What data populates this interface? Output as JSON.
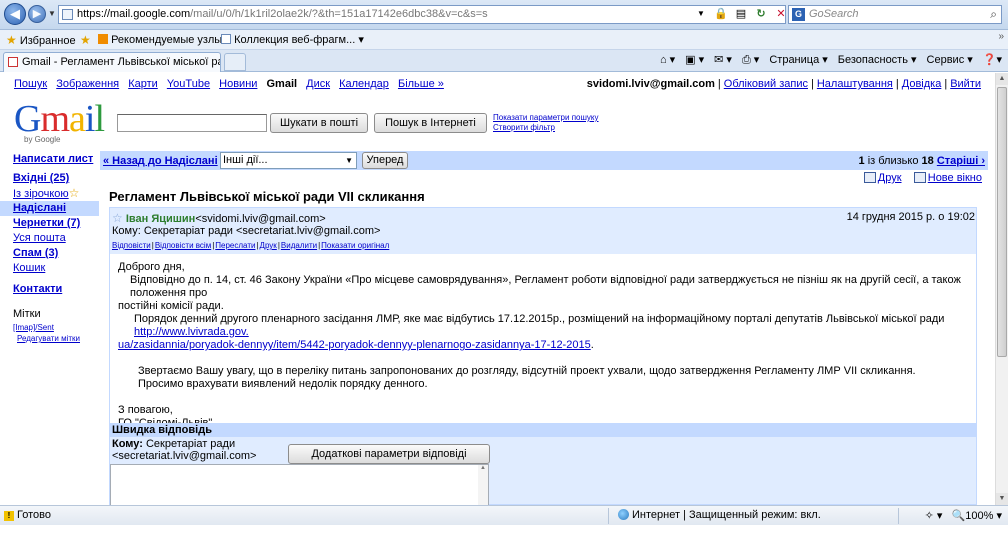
{
  "browser": {
    "url_host": "https://mail.google.com",
    "url_rest": "/mail/u/0/h/1k1ril2olae2k/?&th=151a17142e6dbc38&v=c&s=s",
    "search_placeholder": "GoSearch",
    "favorites_label": "Избранное",
    "fav_items": [
      "Рекомендуемые узлы ▾",
      "Коллекция веб-фрагм... ▾"
    ],
    "tab_title": "Gmail - Регламент Львівської міської ради VII с...",
    "cmd": {
      "page": "Страница ▾",
      "security": "Безопасность ▾",
      "service": "Сервис ▾"
    },
    "status_ready": "Готово",
    "status_zone": "Интернет | Защищенный режим: вкл.",
    "zoom": "100%"
  },
  "gbar": {
    "links": [
      "Пошук",
      "Зображення",
      "Карти",
      "YouTube",
      "Новини"
    ],
    "current": "Gmail",
    "links2": [
      "Диск",
      "Календар",
      "Більше »"
    ],
    "email": "svidomi.lviv@gmail.com",
    "account": "Обліковий запис",
    "settings": "Налаштування",
    "help": "Довідка",
    "logout": "Вийти"
  },
  "search": {
    "btn_mail": "Шукати в пошті",
    "btn_web": "Пошук в Інтернеті",
    "show_options": "Показати параметри пошуку",
    "create_filter": "Створити фільтр"
  },
  "sidebar": {
    "compose": "Написати лист",
    "inbox": "Вхідні (25)",
    "starred": "Із зірочкою",
    "sent": "Надіслані",
    "drafts": "Чернетки (7)",
    "all": "Уся пошта",
    "spam": "Спам (3)",
    "trash": "Кошик",
    "contacts": "Контакти",
    "labels": "Мітки",
    "label_item": "[Imap]/Sent",
    "edit_labels": "Редагувати мітки"
  },
  "msgbar": {
    "back": "« Назад до Надіслані",
    "more_actions": "Інші дії...",
    "forward": "Уперед",
    "pager_first": "1",
    "pager_mid": " із близько ",
    "pager_total": "18",
    "older": "Старіші ›"
  },
  "tools": {
    "print": "Друк",
    "new_window": "Нове вікно"
  },
  "message": {
    "subject": "Регламент Львівської міської ради VII скликання",
    "sender_name": "Іван Яцишин",
    "sender_email": "<svidomi.lviv@gmail.com>",
    "date": "14 грудня 2015 р. о 19:02",
    "to": "Кому: Секретаріат ради <secretariat.lviv@gmail.com>",
    "actions": [
      "Відповісти",
      "Відповісти всім",
      "Переслати",
      "Друк",
      "Видалити",
      "Показати оригінал"
    ],
    "greeting": "Доброго дня,",
    "p1": "Відповідно до п. 14, ст. 46 Закону України «Про місцеве самоврядування», Регламент  роботи відповідної ради затверджується не пізніш як на другій сесії, а також положення про",
    "p1b": "постійні комісії ради.",
    "p2": "Порядок денний другого пленарного засідання ЛМР, яке має відбутись 17.12.2015р.,  розміщений на інформаційному порталі депутатів Львівської міської ради ",
    "p2_link1": "http://www.lvivrada.gov.",
    "p2_link2": "ua/zasidannia/poryadok-dennyy/item/5442-poryadok-dennyy-plenarnogo-zasidannya-17-12-2015",
    "p2_end": ".",
    "p3": "Звертаємо Вашу увагу, що в  переліку питань запропонованих до розгляду, відсутній проект ухвали, щодо затвердження Регламенту ЛМР VII скликання.",
    "p4": "Просимо врахувати виявлений недолік порядку денного.",
    "regards": "З повагою,",
    "org": "ГО \"Свідомі-Львів\""
  },
  "quick_reply": {
    "title": "Швидка відповідь",
    "to_label": "Кому:",
    "to_name": " Секретаріат ради",
    "to_email": "<secretariat.lviv@gmail.com>",
    "more_options": "Додаткові параметри відповіді"
  }
}
